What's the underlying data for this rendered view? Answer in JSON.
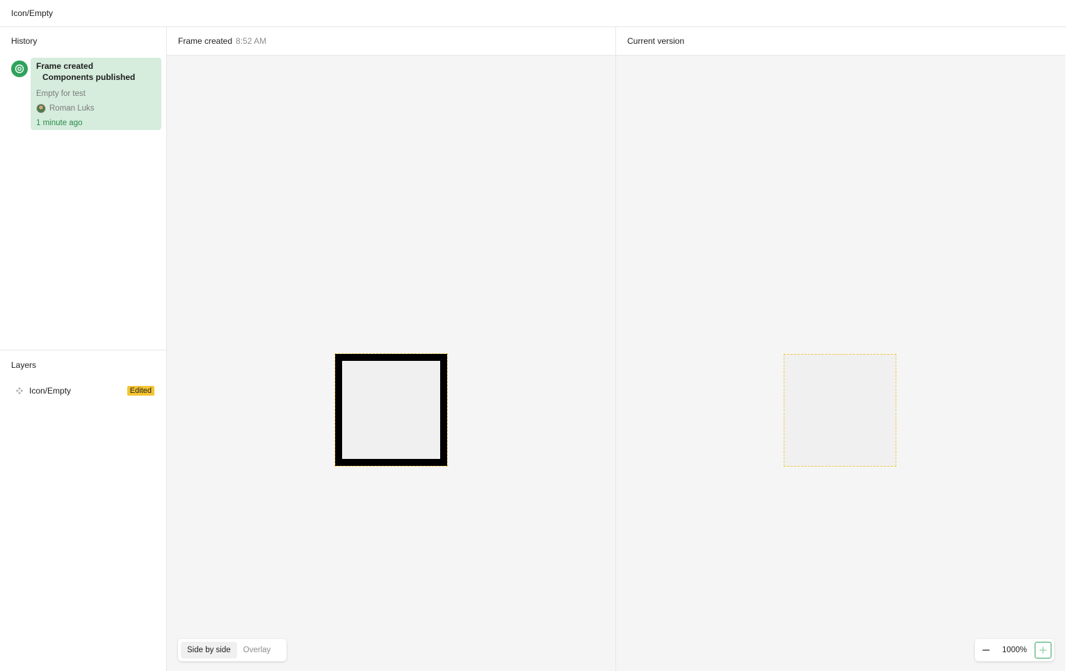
{
  "window": {
    "title": "Icon/Empty"
  },
  "history": {
    "title": "History",
    "versions": [
      {
        "event": "Frame created",
        "subtitle": "Components published",
        "description": "Empty for test",
        "author": "Roman Luks",
        "time_ago": "1 minute ago",
        "icon": "version-target-icon"
      }
    ]
  },
  "layers": {
    "title": "Layers",
    "items": [
      {
        "name": "Icon/Empty",
        "badge": "Edited",
        "icon": "component-icon"
      }
    ]
  },
  "left_panel": {
    "title": "Frame created",
    "time": "8:52 AM"
  },
  "right_panel": {
    "title": "Current version"
  },
  "view_toggle": {
    "options": [
      "Side by side",
      "Overlay"
    ],
    "selected": "Side by side"
  },
  "zoom": {
    "value": "1000%",
    "minus_icon": "minus-icon",
    "plus_icon": "plus-icon"
  },
  "colors": {
    "accent_green": "#2fa25b",
    "selected_card": "#d6eddd",
    "edited_badge": "#f5c431",
    "frame_outline": "#f2c744"
  }
}
